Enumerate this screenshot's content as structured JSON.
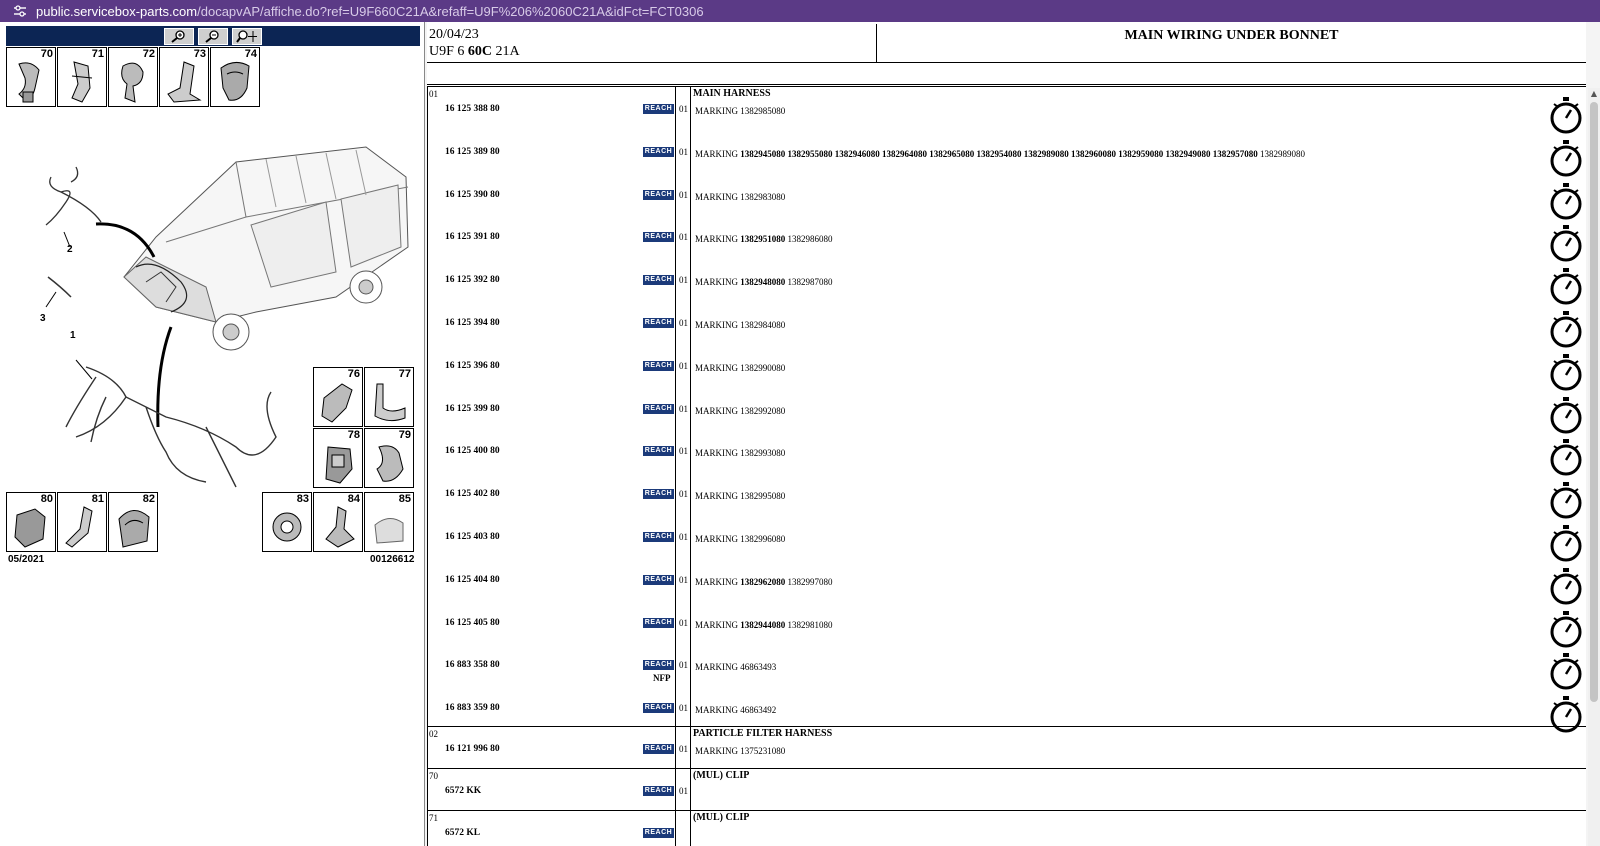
{
  "browser": {
    "url_host": "public.servicebox-parts.com",
    "url_path": "/docapvAP/affiche.do?ref=U9F660C21A&refaff=U9F%206%2060C21A&idFct=FCT0306"
  },
  "diagram": {
    "thumbs_top": [
      "70",
      "71",
      "72",
      "73",
      "74"
    ],
    "thumbs_right": [
      "76",
      "77",
      "78",
      "79"
    ],
    "thumbs_bottom_left": [
      "80",
      "81",
      "82"
    ],
    "thumbs_bottom_right": [
      "83",
      "84",
      "85"
    ],
    "callouts": [
      "1",
      "2",
      "3"
    ],
    "date": "05/2021",
    "ref": "00126612"
  },
  "header": {
    "date": "20/04/23",
    "model_prefix": "U9F 6 ",
    "model_bold": "60C",
    "model_suffix": " 21A",
    "title": "MAIN WIRING UNDER BONNET"
  },
  "reach_label": "REACH",
  "marking_label": "MARKING",
  "groups": [
    {
      "num": "01",
      "title": "MAIN HARNESS",
      "parts": [
        {
          "part": "16 125 388 80",
          "qty": "01",
          "bold": "",
          "normal": "1382985080"
        },
        {
          "part": "16 125 389 80",
          "qty": "01",
          "bold": "1382945080 1382955080 1382946080 1382964080 1382965080 1382954080 1382989080 1382960080 1382959080 1382949080 1382957080",
          "normal": "1382989080"
        },
        {
          "part": "16 125 390 80",
          "qty": "01",
          "bold": "",
          "normal": "1382983080"
        },
        {
          "part": "16 125 391 80",
          "qty": "01",
          "bold": "1382951080",
          "normal": "1382986080"
        },
        {
          "part": "16 125 392 80",
          "qty": "01",
          "bold": "1382948080",
          "normal": "1382987080"
        },
        {
          "part": "16 125 394 80",
          "qty": "01",
          "bold": "",
          "normal": "1382984080"
        },
        {
          "part": "16 125 396 80",
          "qty": "01",
          "bold": "",
          "normal": "1382990080"
        },
        {
          "part": "16 125 399 80",
          "qty": "01",
          "bold": "",
          "normal": "1382992080"
        },
        {
          "part": "16 125 400 80",
          "qty": "01",
          "bold": "",
          "normal": "1382993080"
        },
        {
          "part": "16 125 402 80",
          "qty": "01",
          "bold": "",
          "normal": "1382995080"
        },
        {
          "part": "16 125 403 80",
          "qty": "01",
          "bold": "",
          "normal": "1382996080"
        },
        {
          "part": "16 125 404 80",
          "qty": "01",
          "bold": "1382962080",
          "normal": "1382997080"
        },
        {
          "part": "16 125 405 80",
          "qty": "01",
          "bold": "1382944080",
          "normal": "1382981080"
        },
        {
          "part": "16 883 358 80",
          "qty": "01",
          "bold": "",
          "normal": "46863493",
          "nfp": "NFP"
        },
        {
          "part": "16 883 359 80",
          "qty": "01",
          "bold": "",
          "normal": "46863492"
        }
      ]
    },
    {
      "num": "02",
      "title": "PARTICLE FILTER HARNESS",
      "parts": [
        {
          "part": "16 121 996 80",
          "qty": "01",
          "bold": "",
          "normal": "1375231080"
        }
      ]
    },
    {
      "num": "70",
      "title": "(MUL) CLIP",
      "parts": [
        {
          "part": "6572 KK",
          "qty": "01"
        }
      ]
    },
    {
      "num": "71",
      "title": "(MUL) CLIP",
      "parts": [
        {
          "part": "6572 KL",
          "qty": ""
        }
      ]
    }
  ]
}
